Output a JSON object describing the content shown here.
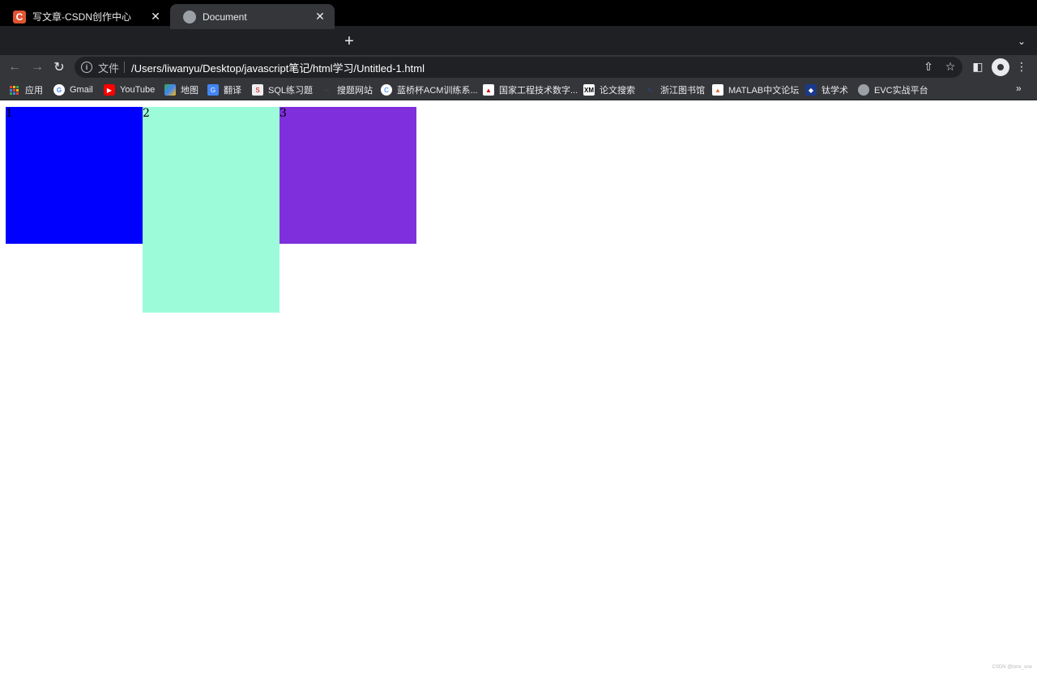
{
  "browser": {
    "tabs": [
      {
        "title": "写文章-CSDN创作中心",
        "favicon": "csdn-icon",
        "active": false
      },
      {
        "title": "Document",
        "favicon": "globe-icon",
        "active": true
      }
    ],
    "scheme_label": "文件",
    "url": "/Users/liwanyu/Desktop/javascript笔记/html学习/Untitled-1.html",
    "bookmarks": [
      {
        "label": "应用",
        "icon": "apps-icon"
      },
      {
        "label": "Gmail",
        "icon": "google-icon"
      },
      {
        "label": "YouTube",
        "icon": "youtube-icon"
      },
      {
        "label": "地图",
        "icon": "maps-icon"
      },
      {
        "label": "翻译",
        "icon": "translate-icon"
      },
      {
        "label": "SQL练习题",
        "icon": "sql-icon"
      },
      {
        "label": "搜题网站",
        "icon": "search-site-icon"
      },
      {
        "label": "蓝桥杯ACM训练系...",
        "icon": "lanqiao-icon"
      },
      {
        "label": "国家工程技术数字...",
        "icon": "library-icon"
      },
      {
        "label": "论文搜索",
        "icon": "xmol-icon"
      },
      {
        "label": "浙江图书馆",
        "icon": "zj-library-icon"
      },
      {
        "label": "MATLAB中文论坛",
        "icon": "matlab-icon"
      },
      {
        "label": "钛学术",
        "icon": "tai-icon"
      },
      {
        "label": "EVC实战平台",
        "icon": "globe-icon"
      }
    ],
    "more_label": "»"
  },
  "page": {
    "boxes": [
      {
        "label": "1",
        "color": "#0000ff"
      },
      {
        "label": "2",
        "color": "#9cfcd9"
      },
      {
        "label": "3",
        "color": "#7f30dc"
      }
    ],
    "watermark": "CSDN @lone_one"
  }
}
